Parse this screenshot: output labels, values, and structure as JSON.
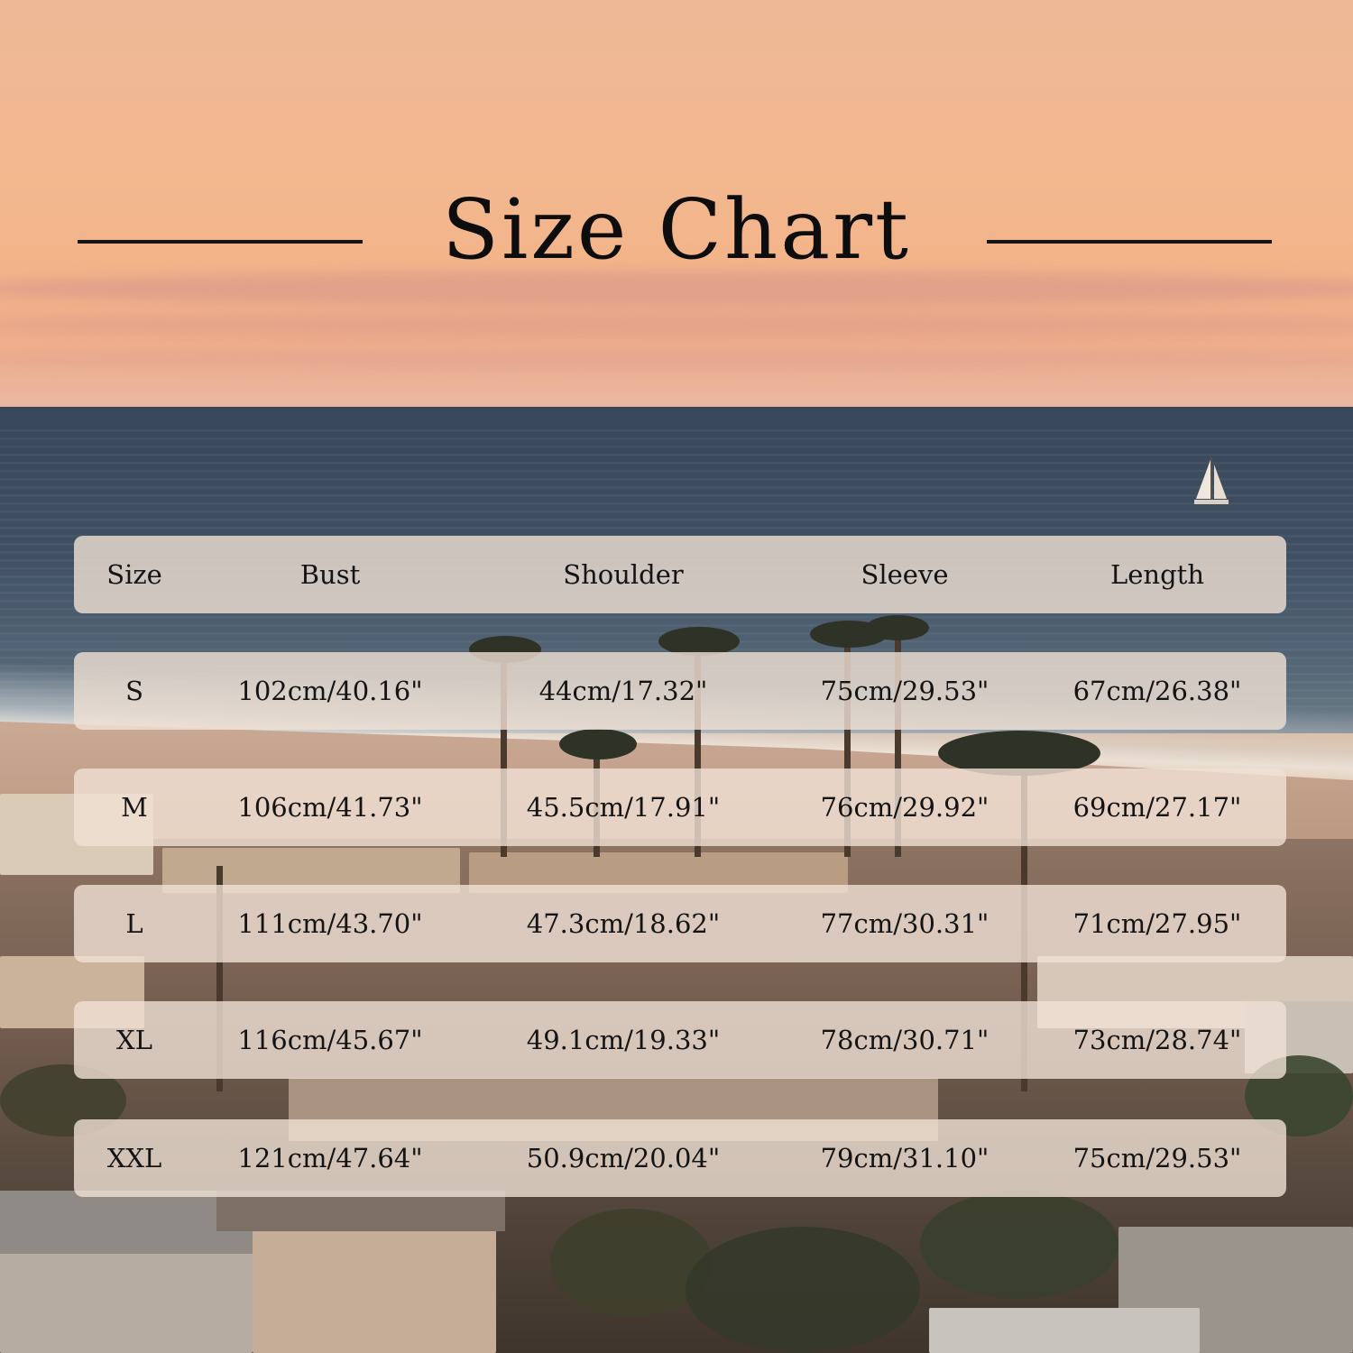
{
  "title": "Size Chart",
  "chart_data": {
    "type": "table",
    "columns": [
      "Size",
      "Bust",
      "Shoulder",
      "Sleeve",
      "Length"
    ],
    "rows": [
      [
        "S",
        "102cm/40.16\"",
        "44cm/17.32\"",
        "75cm/29.53\"",
        "67cm/26.38\""
      ],
      [
        "M",
        "106cm/41.73\"",
        "45.5cm/17.91\"",
        "76cm/29.92\"",
        "69cm/27.17\""
      ],
      [
        "L",
        "111cm/43.70\"",
        "47.3cm/18.62\"",
        "77cm/30.31\"",
        "71cm/27.95\""
      ],
      [
        "XL",
        "116cm/45.67\"",
        "49.1cm/19.33\"",
        "78cm/30.71\"",
        "73cm/28.74\""
      ],
      [
        "XXL",
        "121cm/47.64\"",
        "50.9cm/20.04\"",
        "79cm/31.10\"",
        "75cm/29.53\""
      ]
    ]
  }
}
